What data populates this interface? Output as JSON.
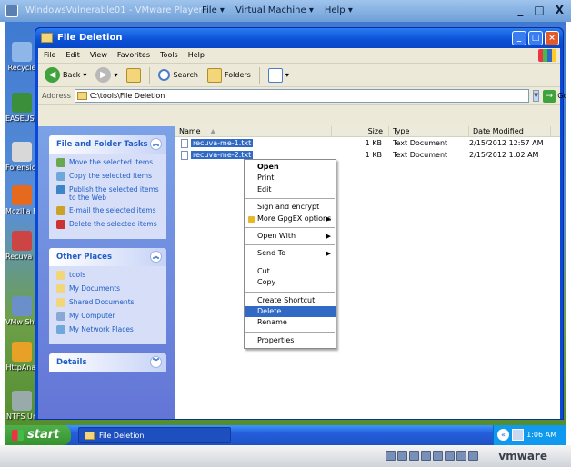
{
  "vm": {
    "title": "WindowsVulnerable01 - VMware Player",
    "menu": [
      "File ▾",
      "Virtual Machine ▾",
      "Help ▾"
    ],
    "controls": [
      "_",
      "□",
      "X"
    ],
    "brand": "vmware"
  },
  "desktop": {
    "icons": [
      {
        "label": "Recycle",
        "color": "#8fb6e8"
      },
      {
        "label": "EASEUS Recove",
        "color": "#3b8f3b"
      },
      {
        "label": "Forensic Toolkit",
        "color": "#d8d8d8"
      },
      {
        "label": "Mozilla Fi",
        "color": "#e66a1e"
      },
      {
        "label": "Recuva Recov",
        "color": "#c44"
      },
      {
        "label": "VMw Shar",
        "color": "#6a8fc9"
      },
      {
        "label": "HttpAnal",
        "color": "#e7a127"
      },
      {
        "label": "NTFS Un",
        "color": "#9aa"
      }
    ]
  },
  "window": {
    "title": "File Deletion",
    "controls": [
      "_",
      "□",
      "×"
    ],
    "menu": [
      "File",
      "Edit",
      "View",
      "Favorites",
      "Tools",
      "Help"
    ],
    "toolbar": {
      "back": "Back",
      "search": "Search",
      "folders": "Folders"
    },
    "address": {
      "label": "Address",
      "value": "C:\\tools\\File Deletion",
      "go": "Go"
    }
  },
  "taskpane": {
    "file_tasks": {
      "title": "File and Folder Tasks",
      "items": [
        {
          "label": "Move the selected items",
          "color": "#6aa84f"
        },
        {
          "label": "Copy the selected items",
          "color": "#6fa8dc"
        },
        {
          "label": "Publish the selected items to the Web",
          "color": "#3d85c6"
        },
        {
          "label": "E-mail the selected items",
          "color": "#c9a227"
        },
        {
          "label": "Delete the selected items",
          "color": "#cc3333"
        }
      ]
    },
    "other_places": {
      "title": "Other Places",
      "items": [
        {
          "label": "tools",
          "color": "#f3d57a"
        },
        {
          "label": "My Documents",
          "color": "#f3d57a"
        },
        {
          "label": "Shared Documents",
          "color": "#f3d57a"
        },
        {
          "label": "My Computer",
          "color": "#8aa7d6"
        },
        {
          "label": "My Network Places",
          "color": "#6fa8dc"
        }
      ]
    },
    "details": {
      "title": "Details"
    }
  },
  "filelist": {
    "columns": [
      "Name",
      "Size",
      "Type",
      "Date Modified"
    ],
    "sort_indicator": "▲",
    "rows": [
      {
        "name": "recuva-me-1.txt",
        "size": "1 KB",
        "type": "Text Document",
        "date": "2/15/2012 12:57 AM"
      },
      {
        "name": "recuva-me-2.txt",
        "size": "1 KB",
        "type": "Text Document",
        "date": "2/15/2012 1:02 AM"
      }
    ]
  },
  "context_menu": {
    "groups": [
      [
        {
          "label": "Open",
          "bold": true
        },
        {
          "label": "Print"
        },
        {
          "label": "Edit"
        }
      ],
      [
        {
          "label": "Sign and encrypt"
        },
        {
          "label": "More GpgEX options",
          "submenu": true,
          "lock": true
        }
      ],
      [
        {
          "label": "Open With",
          "submenu": true
        }
      ],
      [
        {
          "label": "Send To",
          "submenu": true
        }
      ],
      [
        {
          "label": "Cut"
        },
        {
          "label": "Copy"
        }
      ],
      [
        {
          "label": "Create Shortcut"
        },
        {
          "label": "Delete",
          "highlighted": true
        },
        {
          "label": "Rename"
        }
      ],
      [
        {
          "label": "Properties"
        }
      ]
    ],
    "submenu_glyph": "▶"
  },
  "taskbar": {
    "start": "start",
    "task": "File Deletion",
    "tray_arrow": "«",
    "clock": "1:06 AM"
  }
}
